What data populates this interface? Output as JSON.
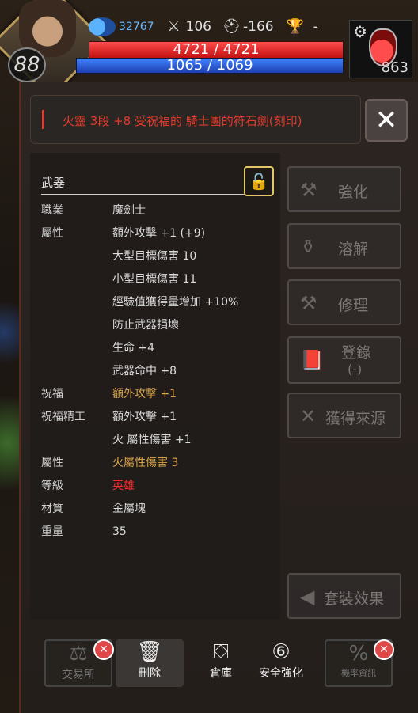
{
  "hud": {
    "level": "88",
    "mp_resource": "32767",
    "attack": "106",
    "defense": "-166",
    "trophy": "-",
    "hp": "4721 / 4721",
    "mp": "1065 / 1069",
    "potion_count": "863"
  },
  "item": {
    "title": "火靈 3段 +8 受祝福的 騎士團的符石劍(刻印)",
    "section": "武器",
    "rows": [
      {
        "k": "職業",
        "v": "魔劍士",
        "style": ""
      },
      {
        "k": "屬性",
        "v": "額外攻擊 +1 (+9)",
        "style": ""
      },
      {
        "k": "",
        "v": "大型目標傷害 10",
        "style": ""
      },
      {
        "k": "",
        "v": "小型目標傷害 11",
        "style": ""
      },
      {
        "k": "",
        "v": "經驗值獲得量增加 +10%",
        "style": ""
      },
      {
        "k": "",
        "v": "防止武器損壞",
        "style": ""
      },
      {
        "k": "",
        "v": "生命 +4",
        "style": ""
      },
      {
        "k": "",
        "v": "武器命中 +8",
        "style": ""
      },
      {
        "k": "祝福",
        "v": "額外攻擊 +1",
        "style": "gold"
      },
      {
        "k": "祝福精工",
        "v": "額外攻擊 +1",
        "style": ""
      },
      {
        "k": "",
        "v": "火 屬性傷害 +1",
        "style": ""
      },
      {
        "k": "屬性",
        "v": "火屬性傷害 3",
        "style": "gold"
      },
      {
        "k": "等級",
        "v": "英雄",
        "style": "red"
      },
      {
        "k": "材質",
        "v": "金屬塊",
        "style": ""
      },
      {
        "k": "重量",
        "v": "35",
        "style": ""
      }
    ]
  },
  "actions": {
    "enhance": "強化",
    "dissolve": "溶解",
    "repair": "修理",
    "register": "登錄",
    "register_sub": "(-)",
    "source": "獲得來源",
    "set_effect": "套裝效果"
  },
  "bottom": {
    "exchange": "交易所",
    "delete": "刪除",
    "warehouse": "倉庫",
    "safe_enhance": "安全強化",
    "rate_info": "機率資訊"
  },
  "colors": {
    "title_red": "#e33a2c",
    "gold": "#d8a24a",
    "hero_red": "#ff2a2a"
  }
}
